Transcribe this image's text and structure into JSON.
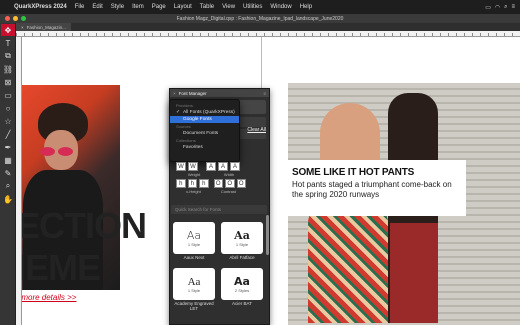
{
  "menubar": {
    "app": "QuarkXPress 2024",
    "items": [
      "File",
      "Edit",
      "Style",
      "Item",
      "Page",
      "Layout",
      "Table",
      "View",
      "Utilities",
      "Window",
      "Help"
    ]
  },
  "window": {
    "title": "Fashion Magz_Digital.qxp : Fashion_Magazine_Ipad_landscape_June2020"
  },
  "tabs": [
    {
      "label": "Fashion_Magazin..."
    }
  ],
  "canvas": {
    "left_text_line1": "ECTION",
    "left_text_line2": "IEME",
    "left_link": "or more details >>",
    "headline": "SOME LIKE IT HOT PANTS",
    "subhead": "Hot pants staged a triumphant come-back on the spring 2020 runways"
  },
  "font_manager": {
    "title": "Font Manager",
    "clear_all": "Clear All",
    "search_placeholder": "Quick Search for Fonts",
    "dropdown": [
      {
        "label": "Providers",
        "type": "header"
      },
      {
        "label": "All Fonts (QuarkXPress)",
        "type": "item",
        "checked": true
      },
      {
        "label": "Google Fonts",
        "type": "item",
        "selected": true
      },
      {
        "label": "Sources",
        "type": "header"
      },
      {
        "label": "Document Fonts",
        "type": "item"
      },
      {
        "label": "Collections",
        "type": "header"
      },
      {
        "label": "Favorites",
        "type": "item"
      }
    ],
    "weight_label": "Weight",
    "width_label": "Width",
    "xheight_label": "x-Height",
    "contrast_label": "Contrast",
    "cards": [
      {
        "sample": "Aa",
        "styles": "1 Style",
        "name": "Aaux Next"
      },
      {
        "sample": "Aa",
        "styles": "1 Style",
        "name": "Abril Fatface"
      },
      {
        "sample": "Aa",
        "styles": "1 Style",
        "name": "Academy Engraved LET"
      },
      {
        "sample": "Aa",
        "styles": "2 Styles",
        "name": "Acier BAT"
      }
    ]
  },
  "colors": {
    "accent": "#c8102e",
    "selection": "#2f6fd8",
    "link": "#d0021b"
  }
}
